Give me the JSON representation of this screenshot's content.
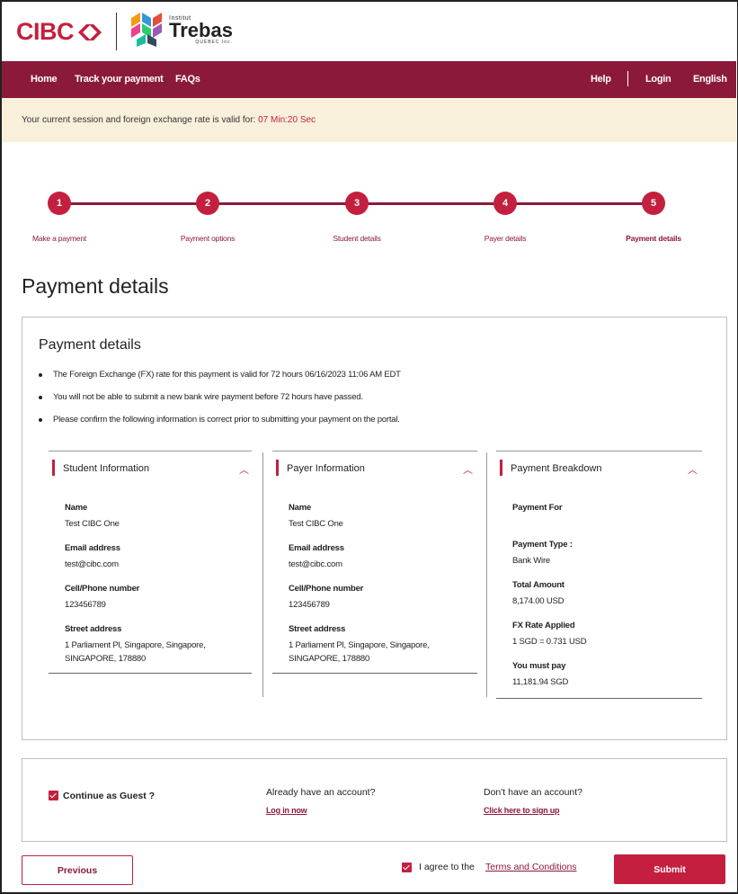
{
  "brand": {
    "cibc_text": "CIBC",
    "partner_small": "Institut",
    "partner_name": "Trebas",
    "partner_sub": "QUÉBEC Inc.",
    "primary_color": "#c41f3e",
    "nav_color": "#8b1a3a"
  },
  "nav": {
    "home": "Home",
    "track": "Track your payment",
    "faqs": "FAQs",
    "help": "Help",
    "login": "Login",
    "language": "English"
  },
  "session": {
    "message": "Your current session and foreign exchange rate is valid for: ",
    "time": "07 Min:20 Sec"
  },
  "steps": [
    {
      "number": "1",
      "label": "Make a payment"
    },
    {
      "number": "2",
      "label": "Payment options"
    },
    {
      "number": "3",
      "label": "Student details"
    },
    {
      "number": "4",
      "label": "Payer details"
    },
    {
      "number": "5",
      "label": "Payment details"
    }
  ],
  "page_title": "Payment details",
  "card": {
    "title": "Payment details",
    "bullets": [
      "The Foreign Exchange (FX) rate for this payment is valid for 72 hours 06/16/2023 11:06 AM EDT",
      "You will not be able to submit a new bank wire payment before 72 hours have passed.",
      "Please confirm the following information is correct prior to submitting your payment on the portal."
    ],
    "student": {
      "title": "Student Information",
      "name_label": "Name",
      "name": "Test CIBC One",
      "email_label": "Email address",
      "email": "test@cibc.com",
      "phone_label": "Cell/Phone number",
      "phone": "123456789",
      "address_label": "Street address",
      "address_line1": "1 Parliament Pl, Singapore, Singapore,",
      "address_line2": "SINGAPORE, 178880"
    },
    "payer": {
      "title": "Payer Information",
      "name_label": "Name",
      "name": "Test CIBC One",
      "email_label": "Email address",
      "email": "test@cibc.com",
      "phone_label": "Cell/Phone number",
      "phone": "123456789",
      "address_label": "Street address",
      "address_line1": "1 Parliament Pl, Singapore, Singapore,",
      "address_line2": "SINGAPORE, 178880"
    },
    "breakdown": {
      "title": "Payment Breakdown",
      "payment_for_label": "Payment For",
      "payment_type_label": "Payment Type :",
      "payment_type": "Bank Wire",
      "total_label": "Total Amount",
      "total": "8,174.00 USD",
      "fx_label": "FX Rate Applied",
      "fx": "1 SGD = 0.731 USD",
      "must_pay_label": "You must pay",
      "must_pay": "11,181.94 SGD"
    },
    "chevron_icon": "chevron-up-icon"
  },
  "account": {
    "guest_label": "Continue as Guest ?",
    "have_account": "Already have an account?",
    "login_link": "Log in now",
    "no_account": "Don't have an account?",
    "signup_link": "Click here to sign up"
  },
  "footer": {
    "previous": "Previous",
    "agree": "I agree to the",
    "terms": "Terms and Conditions",
    "submit": "Submit"
  }
}
